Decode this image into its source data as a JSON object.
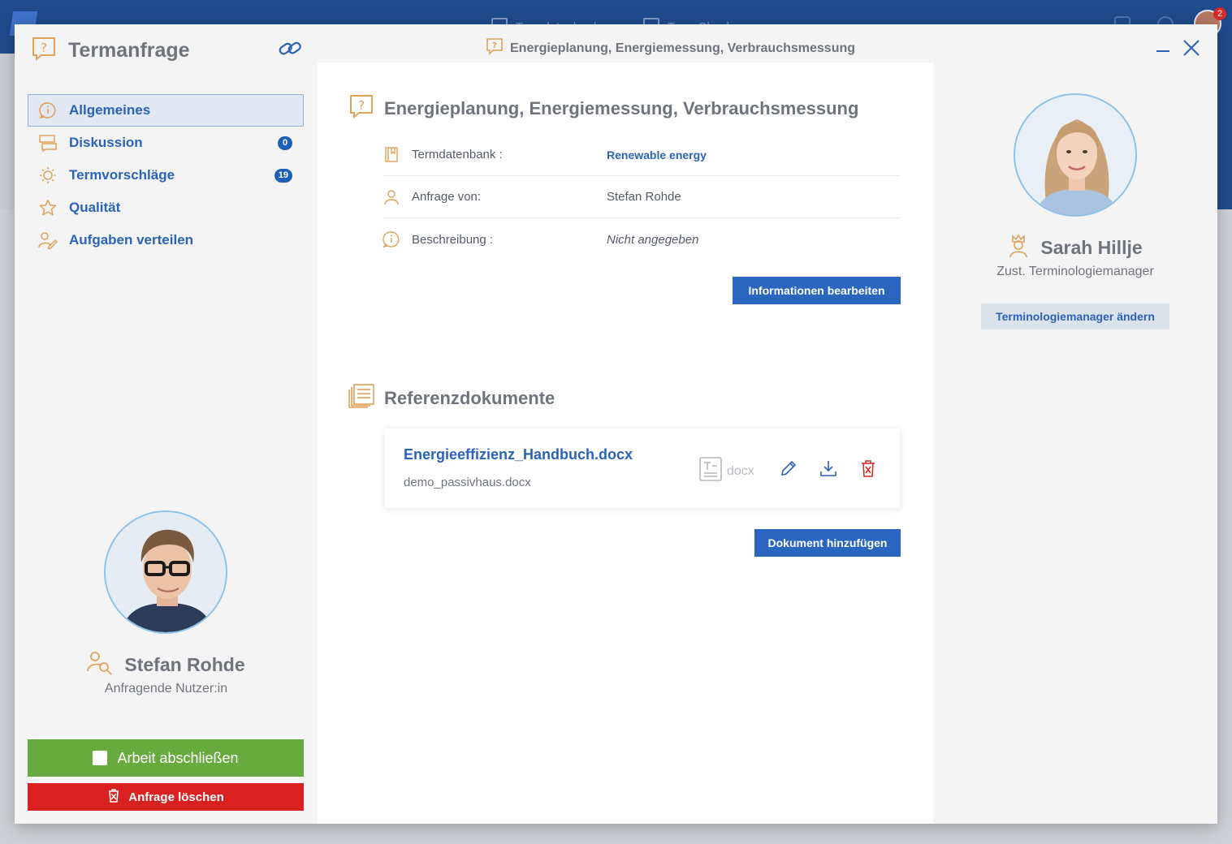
{
  "background": {
    "nav": [
      "Termdatenbanken",
      "Term Checks"
    ],
    "notification_count": "2"
  },
  "modal": {
    "sidebar_title": "Termanfrage",
    "header_title": "Energieplanung, Energiemessung, Verbrauchsmessung",
    "nav": [
      {
        "label": "Allgemeines",
        "icon": "info-bubble-icon",
        "active": true
      },
      {
        "label": "Diskussion",
        "icon": "chat-icon",
        "badge": "0"
      },
      {
        "label": "Termvorschläge",
        "icon": "lightbulb-icon",
        "badge": "19"
      },
      {
        "label": "Qualität",
        "icon": "star-icon"
      },
      {
        "label": "Aufgaben verteilen",
        "icon": "assign-user-icon"
      }
    ],
    "requester": {
      "name": "Stefan Rohde",
      "role": "Anfragende Nutzer:in"
    },
    "finish_label": "Arbeit abschließen",
    "delete_label": "Anfrage löschen"
  },
  "main": {
    "title": "Energieplanung, Energiemessung, Verbrauchsmessung",
    "info": [
      {
        "label": "Termdatenbank :",
        "value": "Renewable energy"
      },
      {
        "label": "Anfrage von:",
        "value": "Stefan Rohde"
      },
      {
        "label": "Beschreibung :",
        "value": "Nicht angegeben"
      }
    ],
    "edit_info_label": "Informationen bearbeiten",
    "ref_title": "Referenzdokumente",
    "documents": [
      {
        "name": "Energieeffizienz_Handbuch.docx",
        "file": "demo_passivhaus.docx",
        "type": "docx"
      }
    ],
    "add_doc_label": "Dokument hinzufügen"
  },
  "assignee": {
    "name": "Sarah Hillje",
    "role": "Zust. Terminologiemanager",
    "change_label": "Terminologiemanager ändern"
  },
  "colors": {
    "accent": "#2a63b8",
    "icon_orange": "#e0a15a",
    "success": "#68aa3d",
    "danger": "#d92121"
  }
}
